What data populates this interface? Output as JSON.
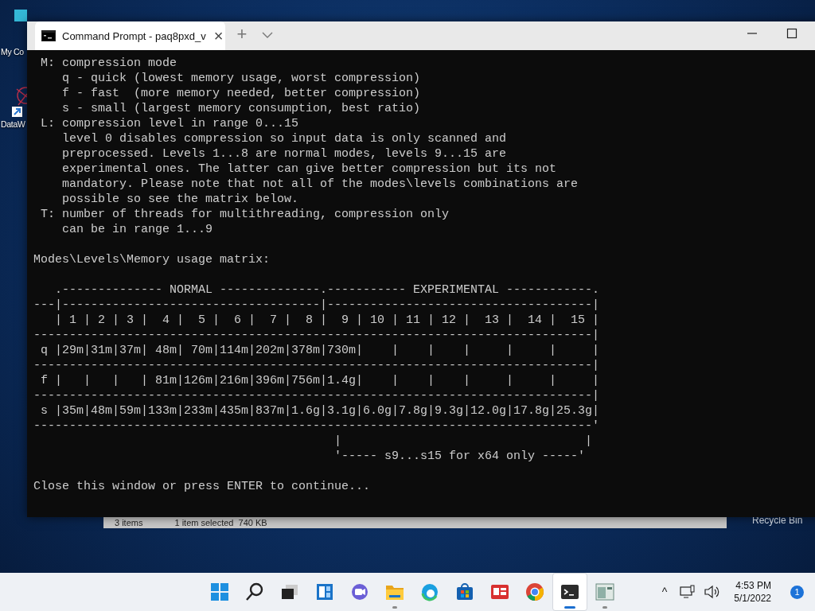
{
  "desktop": {
    "icons": [
      {
        "kind": "monitor",
        "label": "My Co"
      },
      {
        "kind": "shortcut",
        "label": "DataW"
      }
    ],
    "recycle_bin": {
      "label": "Recycle Bin"
    },
    "explorer_status": {
      "items": "3 items",
      "selection": "1 item selected  740 KB"
    }
  },
  "terminal": {
    "tab": {
      "title": "Command Prompt - paq8pxd_v",
      "close": "×"
    },
    "new_tab": "+",
    "blocks": [
      {
        "lines": [
          " M: compression mode",
          "    q - quick (lowest memory usage, worst compression)",
          "    f - fast  (more memory needed, better compression)",
          "    s - small (largest memory consumption, best ratio)",
          " L: compression level in range 0...15",
          "    level 0 disables compression so input data is only scanned and",
          "    preprocessed. Levels 1...8 are normal modes, levels 9...15 are",
          "    experimental ones. The latter can give better compression but its not",
          "    mandatory. Please note that not all of the modes\\levels combinations are",
          "    possible so see the matrix below.",
          " T: number of threads for multithreading, compression only",
          "    can be in range 1...9"
        ]
      },
      {
        "lines": [
          "Modes\\Levels\\Memory usage matrix:"
        ]
      },
      {
        "lines": [
          "   .-------------- NORMAL --------------.----------- EXPERIMENTAL ------------.",
          "---|------------------------------------|-------------------------------------|",
          "   | 1 | 2 | 3 |  4 |  5 |  6 |  7 |  8 |  9 | 10 | 11 | 12 |  13 |  14 |  15 |",
          "------------------------------------------------------------------------------|",
          " q |29m|31m|37m| 48m| 70m|114m|202m|378m|730m|    |    |    |     |     |     |",
          "------------------------------------------------------------------------------|",
          " f |   |   |   | 81m|126m|216m|396m|756m|1.4g|    |    |    |     |     |     |",
          "------------------------------------------------------------------------------|",
          " s |35m|48m|59m|133m|233m|435m|837m|1.6g|3.1g|6.0g|7.8g|9.3g|12.0g|17.8g|25.3g|",
          "------------------------------------------------------------------------------'",
          "                                          |                                  |",
          "                                          '----- s9...s15 for x64 only -----'"
        ]
      },
      {
        "lines": [
          "Close this window or press ENTER to continue..."
        ]
      }
    ]
  },
  "taskbar": {
    "items": [
      {
        "kind": "start",
        "running": false,
        "selected": false
      },
      {
        "kind": "search",
        "running": false,
        "selected": false
      },
      {
        "kind": "taskview",
        "running": false,
        "selected": false
      },
      {
        "kind": "widgets",
        "running": false,
        "selected": false
      },
      {
        "kind": "chat",
        "running": false,
        "selected": false
      },
      {
        "kind": "folder",
        "running": true,
        "selected": false
      },
      {
        "kind": "edge",
        "running": false,
        "selected": false
      },
      {
        "kind": "store",
        "running": false,
        "selected": false
      },
      {
        "kind": "news",
        "running": false,
        "selected": false
      },
      {
        "kind": "chrome",
        "running": false,
        "selected": false
      },
      {
        "kind": "terminal",
        "running": true,
        "selected": true
      },
      {
        "kind": "window",
        "running": true,
        "selected": false
      }
    ],
    "tray": {
      "caret": "^",
      "time": "4:53 PM",
      "date": "5/1/2022",
      "notifications": "1"
    }
  }
}
